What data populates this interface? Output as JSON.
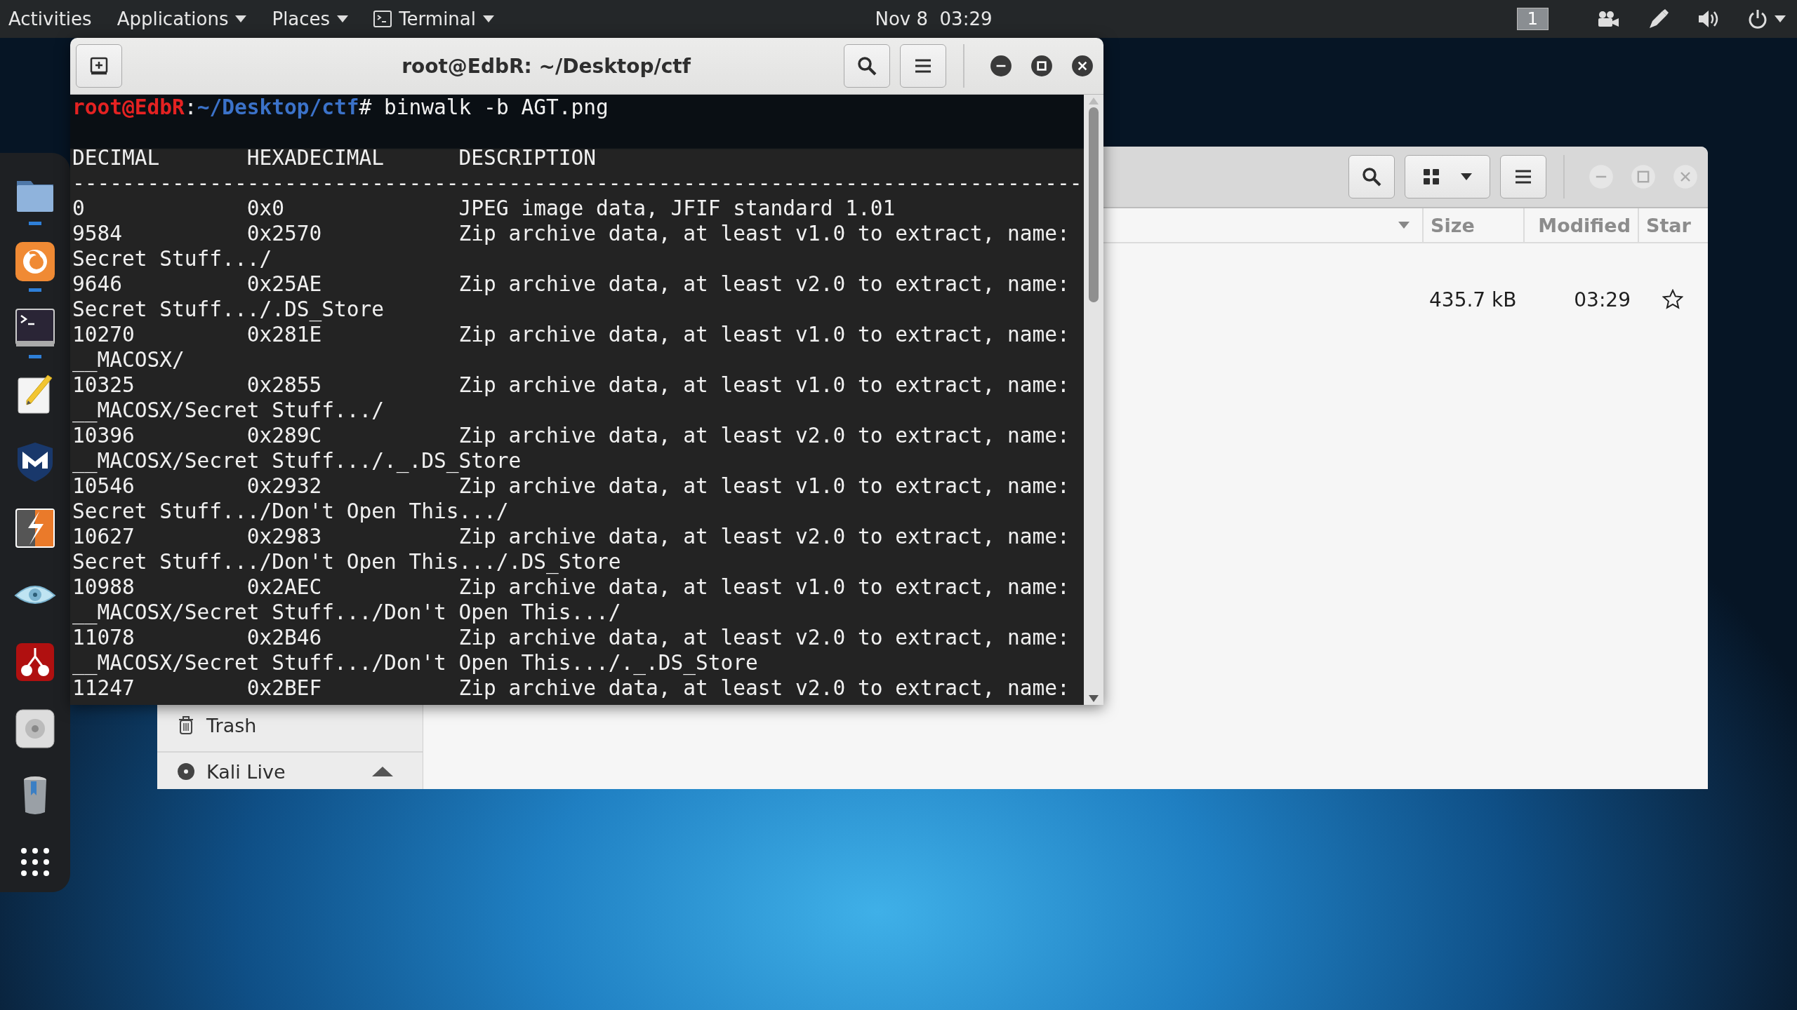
{
  "top_bar": {
    "activities": "Activities",
    "menus": [
      {
        "label": "Applications",
        "kind": "menu"
      },
      {
        "label": "Places",
        "kind": "menu"
      },
      {
        "label": "Terminal",
        "kind": "app"
      }
    ],
    "clock": "Nov 8  03:29",
    "workspace": "1"
  },
  "dock": [
    {
      "kind": "folder",
      "running": true
    },
    {
      "kind": "browser",
      "running": true
    },
    {
      "kind": "terminal",
      "running": true
    },
    {
      "kind": "editor",
      "running": false
    },
    {
      "kind": "shield",
      "running": false
    },
    {
      "kind": "bolt",
      "running": false
    },
    {
      "kind": "eye",
      "running": false
    },
    {
      "kind": "cherry",
      "running": false
    },
    {
      "kind": "disc",
      "running": false
    },
    {
      "kind": "trash",
      "running": false
    },
    {
      "kind": "grid",
      "running": false
    }
  ],
  "file_manager": {
    "columns": [
      {
        "label": "Size"
      },
      {
        "label": "Modified"
      },
      {
        "label": "Star"
      }
    ],
    "rows": [
      {
        "size": "435.7 kB",
        "modified": "03:29",
        "starred": false
      }
    ],
    "sidebar": [
      {
        "label": "Trash",
        "kind": "trash"
      },
      {
        "label": "Kali Live",
        "kind": "drive"
      }
    ]
  },
  "terminal": {
    "title": "root@EdbR: ~/Desktop/ctf",
    "prompt": [
      {
        "text": "root@EdbR",
        "kind": "user"
      },
      {
        "text": ":",
        "kind": "plain"
      },
      {
        "text": "~/Desktop/ctf",
        "kind": "path"
      },
      {
        "text": "# binwalk -b AGT.png",
        "kind": "plain"
      }
    ],
    "columns": [
      "DECIMAL",
      "HEXADECIMAL",
      "DESCRIPTION"
    ],
    "rule": "---------------------------------------------------------------------------------",
    "records": [
      {
        "decimal": "0",
        "hexadecimal": "0x0",
        "description": "JPEG image data, JFIF standard 1.01"
      },
      {
        "decimal": "9584",
        "hexadecimal": "0x2570",
        "description": "Zip archive data, at least v1.0 to extract, name: Secret Stuff.../"
      },
      {
        "decimal": "9646",
        "hexadecimal": "0x25AE",
        "description": "Zip archive data, at least v2.0 to extract, name: Secret Stuff.../.DS_Store"
      },
      {
        "decimal": "10270",
        "hexadecimal": "0x281E",
        "description": "Zip archive data, at least v1.0 to extract, name: __MACOSX/"
      },
      {
        "decimal": "10325",
        "hexadecimal": "0x2855",
        "description": "Zip archive data, at least v1.0 to extract, name: __MACOSX/Secret Stuff.../"
      },
      {
        "decimal": "10396",
        "hexadecimal": "0x289C",
        "description": "Zip archive data, at least v2.0 to extract, name: __MACOSX/Secret Stuff.../._.DS_Store"
      },
      {
        "decimal": "10546",
        "hexadecimal": "0x2932",
        "description": "Zip archive data, at least v1.0 to extract, name: Secret Stuff.../Don't Open This.../"
      },
      {
        "decimal": "10627",
        "hexadecimal": "0x2983",
        "description": "Zip archive data, at least v2.0 to extract, name: Secret Stuff.../Don't Open This.../.DS_Store"
      },
      {
        "decimal": "10988",
        "hexadecimal": "0x2AEC",
        "description": "Zip archive data, at least v1.0 to extract, name: __MACOSX/Secret Stuff.../Don't Open This.../"
      },
      {
        "decimal": "11078",
        "hexadecimal": "0x2B46",
        "description": "Zip archive data, at least v2.0 to extract, name: __MACOSX/Secret Stuff.../Don't Open This.../._.DS_Store"
      },
      {
        "decimal": "11247",
        "hexadecimal": "0x2BEF",
        "description": "Zip archive data, at least v2.0 to extract, name:"
      }
    ]
  }
}
